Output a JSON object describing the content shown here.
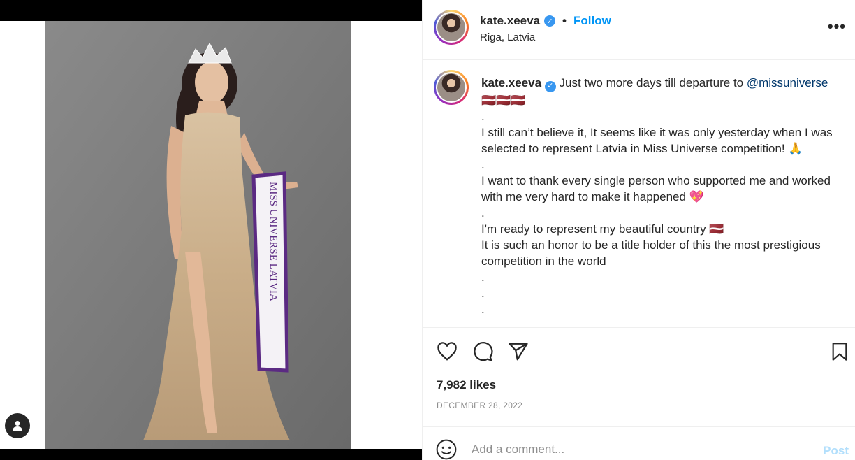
{
  "post": {
    "username": "kate.xeeva",
    "location": "Riga, Latvia",
    "follow_label": "Follow",
    "separator": "•",
    "verified_mark": "✓",
    "more_label": "•••",
    "photo_sash_text": "MISS UNIVERSE LATVIA"
  },
  "caption": {
    "username": "kate.xeeva",
    "text_intro": "Just two more days till departure to",
    "mention": "@missuniverse",
    "emoji_line": "🇱🇻🇱🇻🇱🇻",
    "lines": [
      ".",
      "I still can’t believe it, It seems like it was only yesterday when I was selected to represent Latvia in Miss Universe competition! 🙏",
      ".",
      "I want to thank every single person who supported me and worked with me very hard to make it happened 💖",
      ".",
      "I'm ready to represent my beautiful country 🇱🇻",
      "It is such an honor to be a title holder of this the most prestigious competition in the world",
      ".",
      ".",
      "."
    ]
  },
  "engagement": {
    "likes": "7,982 likes",
    "date": "DECEMBER 28, 2022"
  },
  "comment": {
    "placeholder": "Add a comment...",
    "post_label": "Post"
  },
  "icons": [
    "heart-icon",
    "comment-icon",
    "share-icon",
    "bookmark-icon",
    "emoji-icon",
    "user-tag-icon",
    "more-icon",
    "verified-icon"
  ],
  "colors": {
    "accent": "#0095f6",
    "verified": "#3897f0",
    "mention": "#00376b",
    "muted": "#8e8e8e",
    "post_disabled": "#b2dffc"
  }
}
